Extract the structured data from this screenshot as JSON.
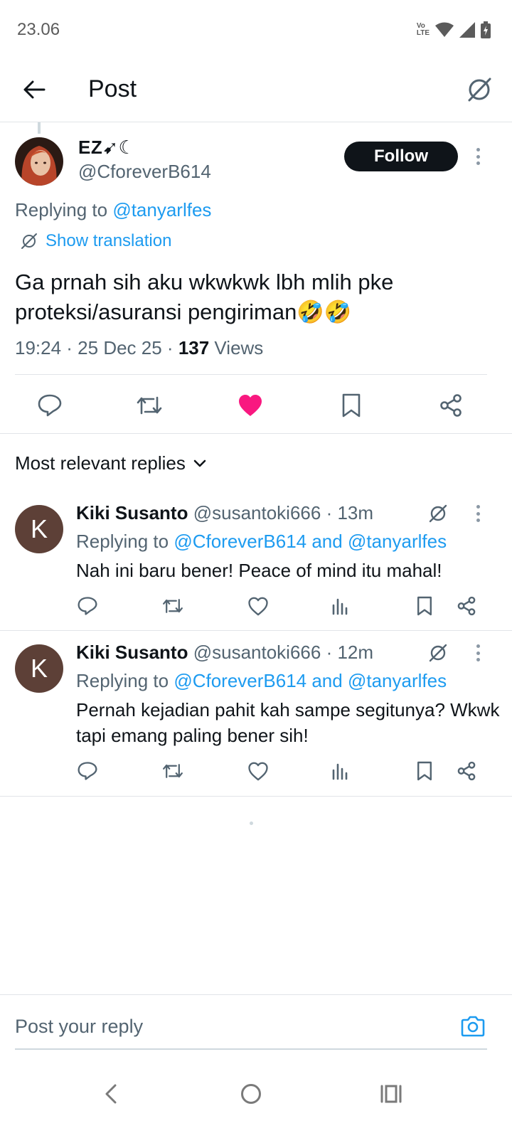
{
  "status_bar": {
    "time": "23.06",
    "icons": [
      "volte-icon",
      "wifi-icon",
      "signal-icon",
      "battery-charging-icon"
    ],
    "volte_top": "Vo",
    "volte_bottom": "LTE"
  },
  "app_bar": {
    "title": "Post",
    "back_icon": "arrow-left-icon",
    "grok_icon": "grok-icon"
  },
  "post": {
    "author_name": "EZ➹☾",
    "author_handle": "@CforeverB614",
    "follow_label": "Follow",
    "replying_prefix": "Replying to ",
    "replying_to": "@tanyarlfes",
    "translation_label": "Show translation",
    "text": "Ga prnah sih aku wkwkwk lbh mlih pke proteksi/asuransi pengiriman🤣🤣",
    "time": "19:24 · 25 Dec 25 · ",
    "views_count": "137",
    "views_label": " Views",
    "liked": true,
    "like_color": "#f91880"
  },
  "sort": {
    "label": "Most relevant replies"
  },
  "replies": [
    {
      "avatar_letter": "K",
      "name": "Kiki Susanto",
      "handle": "@susantoki666",
      "time": " · 13m",
      "replying_prefix": "Replying to ",
      "replying_to": "@CforeverB614 and @tanyarlfes",
      "text": "Nah ini baru bener! Peace of mind itu mahal!"
    },
    {
      "avatar_letter": "K",
      "name": "Kiki Susanto",
      "handle": "@susantoki666",
      "time": " · 12m",
      "replying_prefix": "Replying to ",
      "replying_to": "@CforeverB614 and @tanyarlfes",
      "text": "Pernah kejadian pahit kah sampe segitunya? Wkwk tapi emang paling bener sih!"
    }
  ],
  "compose": {
    "placeholder": "Post your reply",
    "camera_icon": "camera-icon"
  },
  "nav": {
    "icons": [
      "nav-back-icon",
      "nav-home-icon",
      "nav-recents-icon"
    ]
  },
  "colors": {
    "accent": "#1d9bf0",
    "text": "#0f1419",
    "secondary": "#536471",
    "avatar_bg": "#5d4037"
  }
}
